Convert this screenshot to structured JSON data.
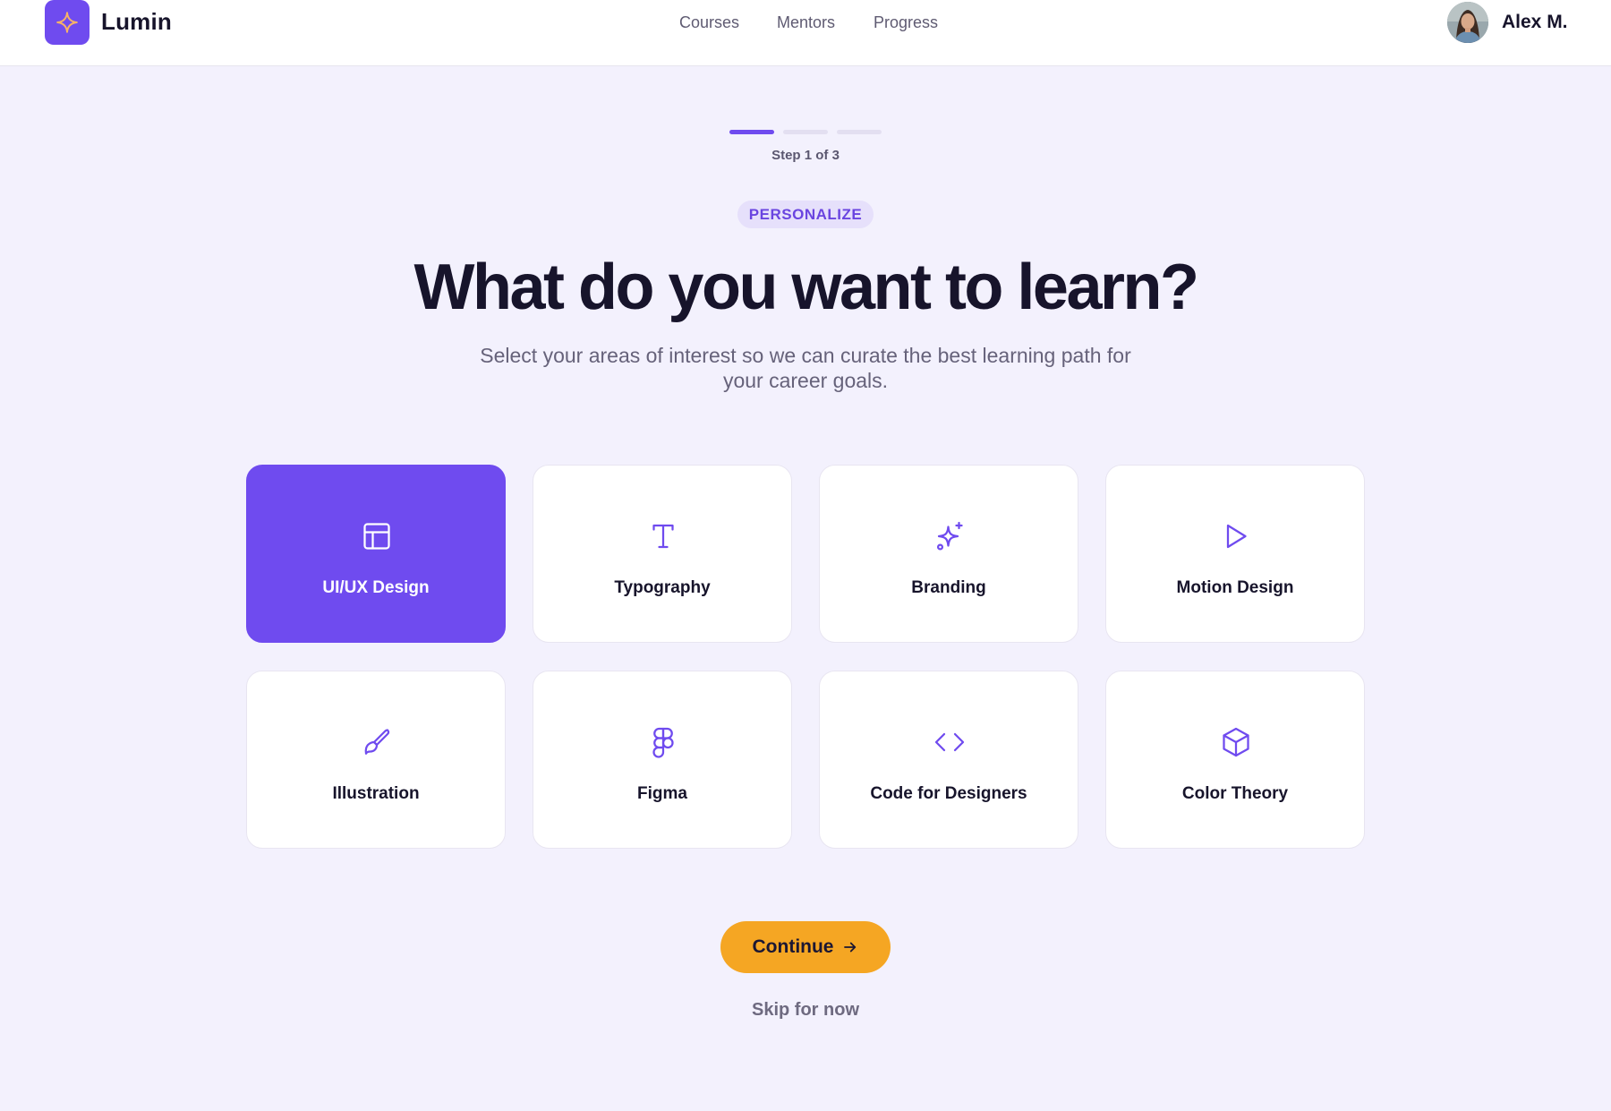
{
  "header": {
    "brand": "Lumin",
    "nav": [
      "Courses",
      "Mentors",
      "Progress"
    ],
    "user_name": "Alex M."
  },
  "onboarding": {
    "step_label": "Step 1 of 3",
    "current_step": 1,
    "total_steps": 3,
    "badge": "PERSONALIZE",
    "headline": "What do you want to learn?",
    "subtitle_line1": "Select your areas of interest so we can curate the best learning path for",
    "subtitle_line2": "your career goals."
  },
  "topics": [
    {
      "label": "UI/UX Design",
      "icon": "layout-icon",
      "selected": true
    },
    {
      "label": "Typography",
      "icon": "type-icon",
      "selected": false
    },
    {
      "label": "Branding",
      "icon": "sparkles-icon",
      "selected": false
    },
    {
      "label": "Motion Design",
      "icon": "play-icon",
      "selected": false
    },
    {
      "label": "Illustration",
      "icon": "brush-icon",
      "selected": false
    },
    {
      "label": "Figma",
      "icon": "figma-icon",
      "selected": false
    },
    {
      "label": "Code for Designers",
      "icon": "code-icon",
      "selected": false
    },
    {
      "label": "Color Theory",
      "icon": "cube-icon",
      "selected": false
    }
  ],
  "actions": {
    "continue_label": "Continue",
    "skip_label": "Skip for now"
  },
  "colors": {
    "accent": "#6f4bef",
    "cta": "#f5a623",
    "background": "#f3f1fd",
    "logo_star": "#f7b267"
  }
}
